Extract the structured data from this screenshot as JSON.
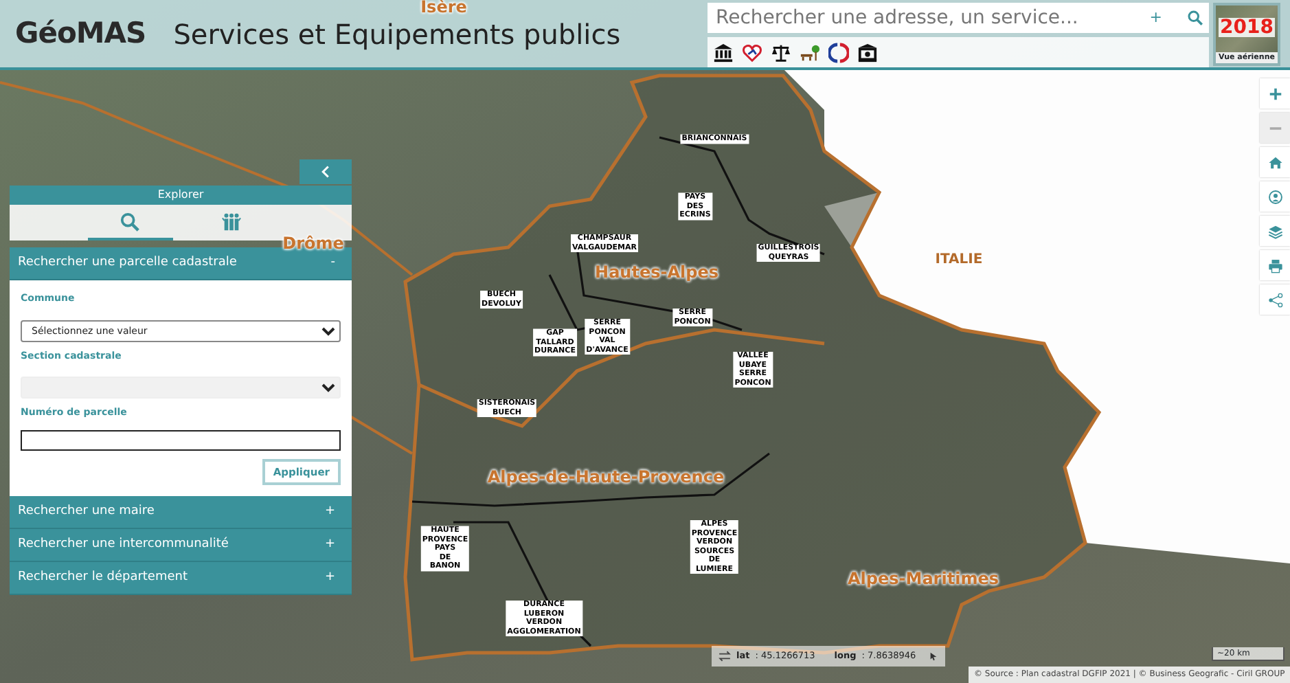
{
  "header": {
    "logo": "GéoMAS",
    "title": "Services et Equipements publics",
    "search": {
      "placeholder": "Rechercher une adresse, un service...",
      "add": "+"
    },
    "aerial": {
      "year": "2018",
      "label": "Vue aérienne"
    }
  },
  "map_labels": [
    {
      "kind": "department",
      "text": "Isère"
    },
    {
      "kind": "department",
      "text": "Drôme"
    },
    {
      "kind": "country",
      "text": "ITALIE"
    },
    {
      "kind": "department",
      "text": "Hautes-Alpes"
    },
    {
      "kind": "department",
      "text": "Alpes-de-Haute-Provence"
    },
    {
      "kind": "department",
      "text": "Alpes-Maritimes"
    },
    {
      "kind": "epci",
      "lines": [
        "BRIANCONNAIS"
      ]
    },
    {
      "kind": "epci",
      "lines": [
        "PAYS",
        "DES",
        "ECRINS"
      ]
    },
    {
      "kind": "epci",
      "lines": [
        "CHAMPSAUR",
        "VALGAUDEMAR"
      ]
    },
    {
      "kind": "epci",
      "lines": [
        "GUILLESTROIS",
        "QUEYRAS"
      ]
    },
    {
      "kind": "epci",
      "lines": [
        "BUECH",
        "DEVOLUY"
      ]
    },
    {
      "kind": "epci",
      "lines": [
        "SERRE",
        "PONCON"
      ]
    },
    {
      "kind": "epci",
      "lines": [
        "GAP",
        "TALLARD",
        "DURANCE"
      ]
    },
    {
      "kind": "epci",
      "lines": [
        "SERRE",
        "PONCON",
        "VAL",
        "D'AVANCE"
      ]
    },
    {
      "kind": "epci",
      "lines": [
        "VALLEE",
        "UBAYE",
        "SERRE",
        "PONCON"
      ]
    },
    {
      "kind": "epci",
      "lines": [
        "SISTERONAIS",
        "BUECH"
      ]
    },
    {
      "kind": "epci",
      "lines": [
        "HAUTE",
        "PROVENCE",
        "PAYS",
        "DE",
        "BANON"
      ]
    },
    {
      "kind": "epci",
      "lines": [
        "ALPES",
        "PROVENCE",
        "VERDON",
        "SOURCES",
        "DE",
        "LUMIERE"
      ]
    },
    {
      "kind": "epci",
      "lines": [
        "DURANCE",
        "LUBERON",
        "VERDON",
        "AGGLOMERATION"
      ]
    }
  ],
  "panel": {
    "title": "Explorer",
    "tabs": [
      {
        "kind": "search",
        "selected": true
      },
      {
        "kind": "people",
        "selected": false
      }
    ],
    "sections": [
      {
        "title": "Rechercher une parcelle cadastrale",
        "toggle": "-",
        "expanded": true,
        "fields": [
          {
            "kind": "select",
            "label": "Commune",
            "value": "Sélectionnez une valeur",
            "disabled": false
          },
          {
            "kind": "select",
            "label": "Section cadastrale",
            "disabled": true
          },
          {
            "kind": "input",
            "label": "Numéro de parcelle"
          }
        ],
        "button": "Appliquer"
      },
      {
        "title": "Rechercher une maire",
        "toggle": "+",
        "expanded": false
      },
      {
        "title": "Rechercher une intercommunalité",
        "toggle": "+",
        "expanded": false
      },
      {
        "title": "Rechercher le département",
        "toggle": "+",
        "expanded": false
      }
    ]
  },
  "map_controls": [
    {
      "kind": "zoom_in",
      "disabled": false
    },
    {
      "kind": "zoom_out",
      "disabled": true
    },
    {
      "kind": "home",
      "disabled": false
    },
    {
      "kind": "user",
      "disabled": false
    },
    {
      "kind": "layers",
      "disabled": false
    },
    {
      "kind": "print",
      "disabled": false
    },
    {
      "kind": "share",
      "disabled": false
    }
  ],
  "coordinates": {
    "lat_label": "lat",
    "lat_value": ": 45.1266713",
    "long_label": "long",
    "long_value": ": 7.8638946"
  },
  "scale": "~20 km",
  "attribution": "© Source : Plan cadastral DGFIP 2021 | © Business Geografic - Ciril GROUP"
}
